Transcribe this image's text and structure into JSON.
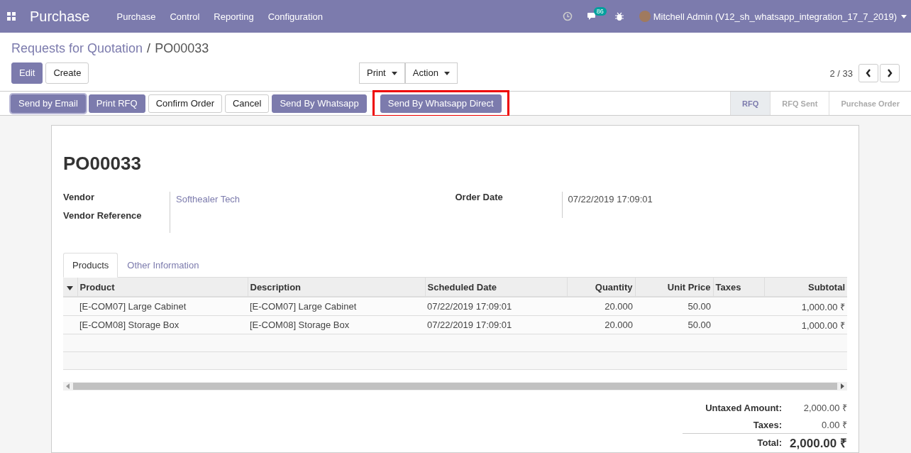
{
  "navbar": {
    "app_name": "Purchase",
    "menu": [
      "Purchase",
      "Control",
      "Reporting",
      "Configuration"
    ],
    "message_count": "86",
    "user": "Mitchell Admin (V12_sh_whatsapp_integration_17_7_2019)"
  },
  "breadcrumb": {
    "parent": "Requests for Quotation",
    "separator": "/",
    "current": "PO00033"
  },
  "control_buttons": [
    {
      "label": "Edit",
      "kind": "primary"
    },
    {
      "label": "Create",
      "kind": "secondary"
    }
  ],
  "dropdowns": [
    "Print",
    "Action"
  ],
  "pager": "2 / 33",
  "action_buttons": [
    {
      "label": "Send by Email",
      "kind": "primary",
      "highlighted": false
    },
    {
      "label": "Print RFQ",
      "kind": "primary",
      "highlighted": false
    },
    {
      "label": "Confirm Order",
      "kind": "secondary",
      "highlighted": false
    },
    {
      "label": "Cancel",
      "kind": "secondary",
      "highlighted": false
    },
    {
      "label": "Send By Whatsapp",
      "kind": "primary",
      "highlighted": false
    },
    {
      "label": "Send By Whatsapp Direct",
      "kind": "primary",
      "highlighted": true
    }
  ],
  "stages": [
    {
      "label": "RFQ",
      "selected": true
    },
    {
      "label": "RFQ Sent",
      "selected": false
    },
    {
      "label": "Purchase Order",
      "selected": false
    }
  ],
  "form": {
    "title": "PO00033",
    "left_fields": [
      {
        "label": "Vendor",
        "value": "Softhealer Tech"
      },
      {
        "label": "Vendor Reference"
      }
    ],
    "right_fields": [
      {
        "label": "Order Date",
        "value": "07/22/2019 17:09:01"
      }
    ],
    "tabs": [
      {
        "label": "Products",
        "selected": true
      },
      {
        "label": "Other Information",
        "selected": false
      }
    ],
    "table": {
      "columns": [
        "Product",
        "Description",
        "Scheduled Date",
        "Quantity",
        "Unit Price",
        "Taxes",
        "Subtotal"
      ],
      "rows": [
        [
          "[E-COM07] Large Cabinet",
          "[E-COM07] Large Cabinet",
          "07/22/2019 17:09:01",
          "20.000",
          "50.00",
          "",
          "1,000.00 ₹"
        ],
        [
          "[E-COM08] Storage Box",
          "[E-COM08] Storage Box",
          "07/22/2019 17:09:01",
          "20.000",
          "50.00",
          "",
          "1,000.00 ₹"
        ]
      ]
    },
    "totals": [
      {
        "label": "Untaxed Amount:",
        "value": "2,000.00 ₹",
        "kind": "normal"
      },
      {
        "label": "Taxes:",
        "value": "0.00 ₹",
        "kind": "normal"
      },
      {
        "label": "Total:",
        "value": "2,000.00 ₹",
        "kind": "grand"
      }
    ]
  }
}
